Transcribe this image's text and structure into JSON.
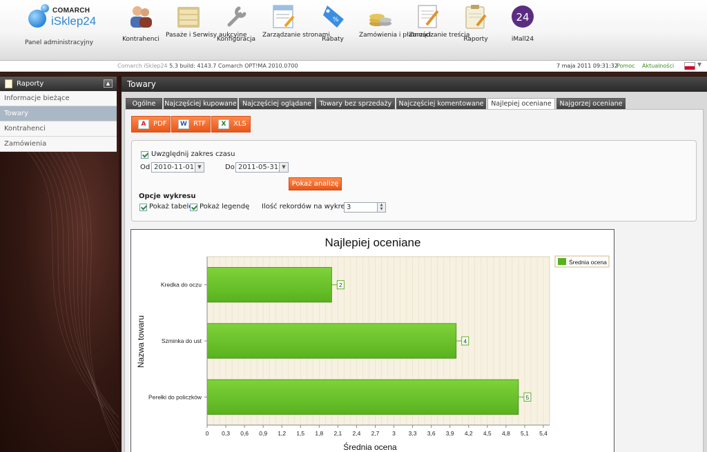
{
  "header": {
    "brand": "COMARCH",
    "product": "iSklep24",
    "panel_label": "Panel administracyjny",
    "nav": [
      {
        "label": "Kontrahenci",
        "icon": "users-icon"
      },
      {
        "label": "Pasaże i Serwisy aukcyjne",
        "icon": "folders-icon"
      },
      {
        "label": "Konfiguracja",
        "icon": "wrench-icon"
      },
      {
        "label": "Zarządzanie stronami",
        "icon": "page-edit-icon"
      },
      {
        "label": "Rabaty",
        "icon": "discount-tag-icon"
      },
      {
        "label": "Zamówienia i płatności",
        "icon": "coins-icon"
      },
      {
        "label": "Zarządzanie treścią",
        "icon": "document-edit-icon"
      },
      {
        "label": "Raporty",
        "icon": "clipboard-icon"
      },
      {
        "label": "iMall24",
        "icon": "imall-24-icon",
        "badge": "24"
      }
    ]
  },
  "infobar": {
    "version_muted": "Comarch iSklep24",
    "version": "5.3 build: 4143.7  Comarch OPT!MA 2010.0700",
    "datetime": "7 maja 2011 09:31:32",
    "help": "Pomoc",
    "news": "Aktualności"
  },
  "sidebar": {
    "title": "Raporty",
    "items": [
      {
        "label": "Informacje bieżące",
        "active": false
      },
      {
        "label": "Towary",
        "active": true
      },
      {
        "label": "Kontrahenci",
        "active": false
      },
      {
        "label": "Zamówienia",
        "active": false
      }
    ]
  },
  "main": {
    "title": "Towary",
    "tabs": [
      {
        "label": "Ogólne",
        "active": false
      },
      {
        "label": "Najczęściej kupowane",
        "active": false
      },
      {
        "label": "Najczęściej oglądane",
        "active": false
      },
      {
        "label": "Towary bez sprzedaży",
        "active": false
      },
      {
        "label": "Najczęściej komentowane",
        "active": false
      },
      {
        "label": "Najlepiej oceniane",
        "active": true
      },
      {
        "label": "Najgorzej oceniane",
        "active": false
      }
    ],
    "export": {
      "pdf": "PDF",
      "rtf": "RTF",
      "xls": "XLS"
    },
    "filters": {
      "include_range_label": "Uwzględnij zakres czasu",
      "include_range_checked": true,
      "from_label": "Od",
      "from_value": "2010-11-01",
      "to_label": "Do",
      "to_value": "2011-05-31",
      "show_button": "Pokaż analizę",
      "chart_options_title": "Opcje wykresu",
      "show_table_label": "Pokaż tabelę",
      "show_table_checked": true,
      "show_legend_label": "Pokaż legendę",
      "show_legend_checked": true,
      "records_label": "Ilość rekordów na wykresie",
      "records_value": "3"
    }
  },
  "chart_data": {
    "type": "bar",
    "orientation": "horizontal",
    "title": "Najlepiej oceniane",
    "xlabel": "Średnia ocena",
    "ylabel": "Nazwa towaru",
    "categories": [
      "Kredka do oczu",
      "Szminka do ust",
      "Perełki do policzków"
    ],
    "series": [
      {
        "name": "Średnia ocena",
        "values": [
          2,
          4,
          5
        ],
        "color": "#58b21e"
      }
    ],
    "data_labels": [
      "2",
      "4",
      "5"
    ],
    "xlim": [
      0,
      5.5
    ],
    "xticks": [
      "0",
      "0,3",
      "0,6",
      "0,9",
      "1,2",
      "1,5",
      "1,8",
      "2,1",
      "2,4",
      "2,7",
      "3",
      "3,3",
      "3,6",
      "3,9",
      "4,2",
      "4,5",
      "4,8",
      "5,1",
      "5,4"
    ],
    "xtick_values": [
      0,
      0.3,
      0.6,
      0.9,
      1.2,
      1.5,
      1.8,
      2.1,
      2.4,
      2.7,
      3,
      3.3,
      3.6,
      3.9,
      4.2,
      4.5,
      4.8,
      5.1,
      5.4
    ],
    "grid": true,
    "legend_position": "top-right"
  },
  "colors": {
    "accent": "#ef6a2c",
    "link": "#3a8d1f",
    "bar": "#58b21e",
    "plot_bg": "#f7f1e2"
  }
}
